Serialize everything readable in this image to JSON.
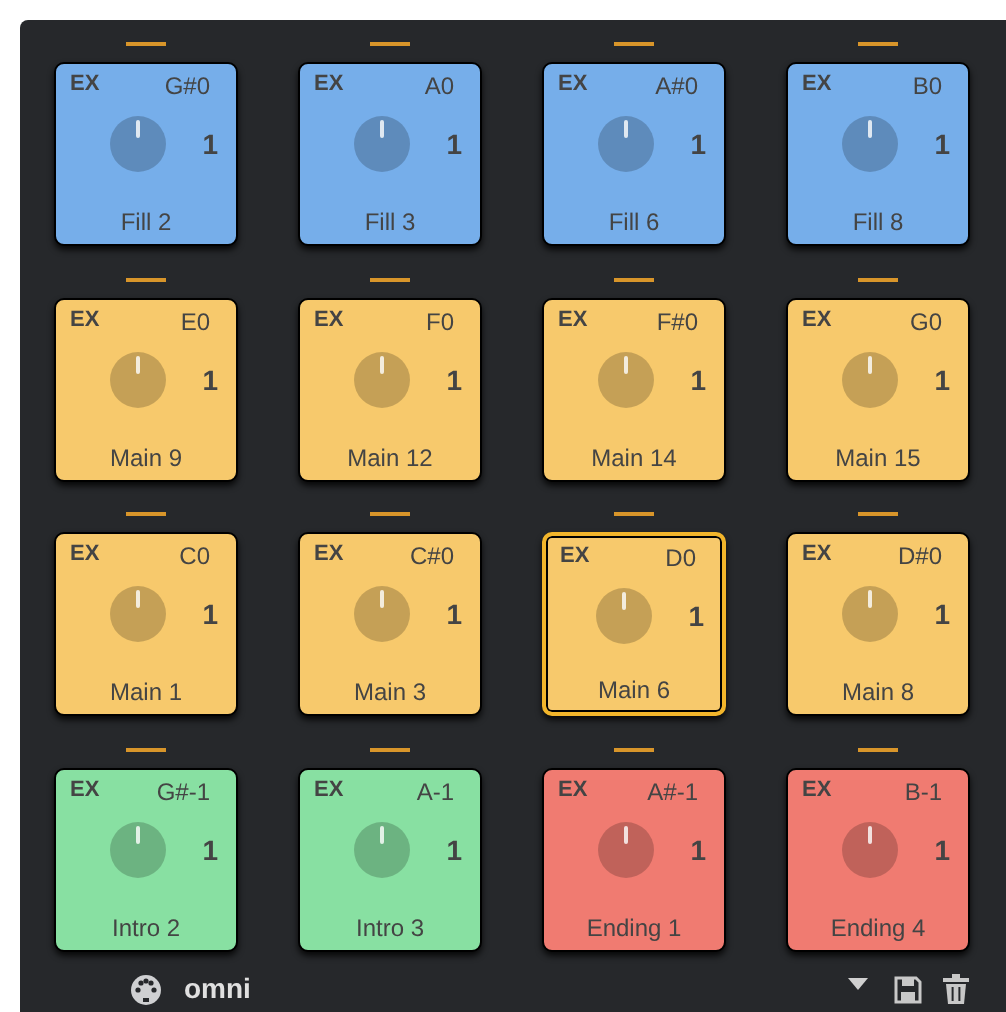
{
  "pads": [
    {
      "tag": "EX",
      "note": "G#0",
      "value": "1",
      "name": "Fill 2",
      "color": "#76aeea",
      "selected": false
    },
    {
      "tag": "EX",
      "note": "A0",
      "value": "1",
      "name": "Fill 3",
      "color": "#76aeea",
      "selected": false
    },
    {
      "tag": "EX",
      "note": "A#0",
      "value": "1",
      "name": "Fill 6",
      "color": "#76aeea",
      "selected": false
    },
    {
      "tag": "EX",
      "note": "B0",
      "value": "1",
      "name": "Fill 8",
      "color": "#76aeea",
      "selected": false
    },
    {
      "tag": "EX",
      "note": "E0",
      "value": "1",
      "name": "Main 9",
      "color": "#f7c96c",
      "selected": false
    },
    {
      "tag": "EX",
      "note": "F0",
      "value": "1",
      "name": "Main 12",
      "color": "#f7c96c",
      "selected": false
    },
    {
      "tag": "EX",
      "note": "F#0",
      "value": "1",
      "name": "Main 14",
      "color": "#f7c96c",
      "selected": false
    },
    {
      "tag": "EX",
      "note": "G0",
      "value": "1",
      "name": "Main 15",
      "color": "#f7c96c",
      "selected": false
    },
    {
      "tag": "EX",
      "note": "C0",
      "value": "1",
      "name": "Main 1",
      "color": "#f7c96c",
      "selected": false
    },
    {
      "tag": "EX",
      "note": "C#0",
      "value": "1",
      "name": "Main 3",
      "color": "#f7c96c",
      "selected": false
    },
    {
      "tag": "EX",
      "note": "D0",
      "value": "1",
      "name": "Main 6",
      "color": "#f7c96c",
      "selected": true
    },
    {
      "tag": "EX",
      "note": "D#0",
      "value": "1",
      "name": "Main 8",
      "color": "#f7c96c",
      "selected": false
    },
    {
      "tag": "EX",
      "note": "G#-1",
      "value": "1",
      "name": "Intro 2",
      "color": "#88e0a2",
      "selected": false
    },
    {
      "tag": "EX",
      "note": "A-1",
      "value": "1",
      "name": "Intro 3",
      "color": "#88e0a2",
      "selected": false
    },
    {
      "tag": "EX",
      "note": "A#-1",
      "value": "1",
      "name": "Ending 1",
      "color": "#f07b71",
      "selected": false
    },
    {
      "tag": "EX",
      "note": "B-1",
      "value": "1",
      "name": "Ending 4",
      "color": "#f07b71",
      "selected": false
    }
  ],
  "footer": {
    "port": "omni"
  }
}
